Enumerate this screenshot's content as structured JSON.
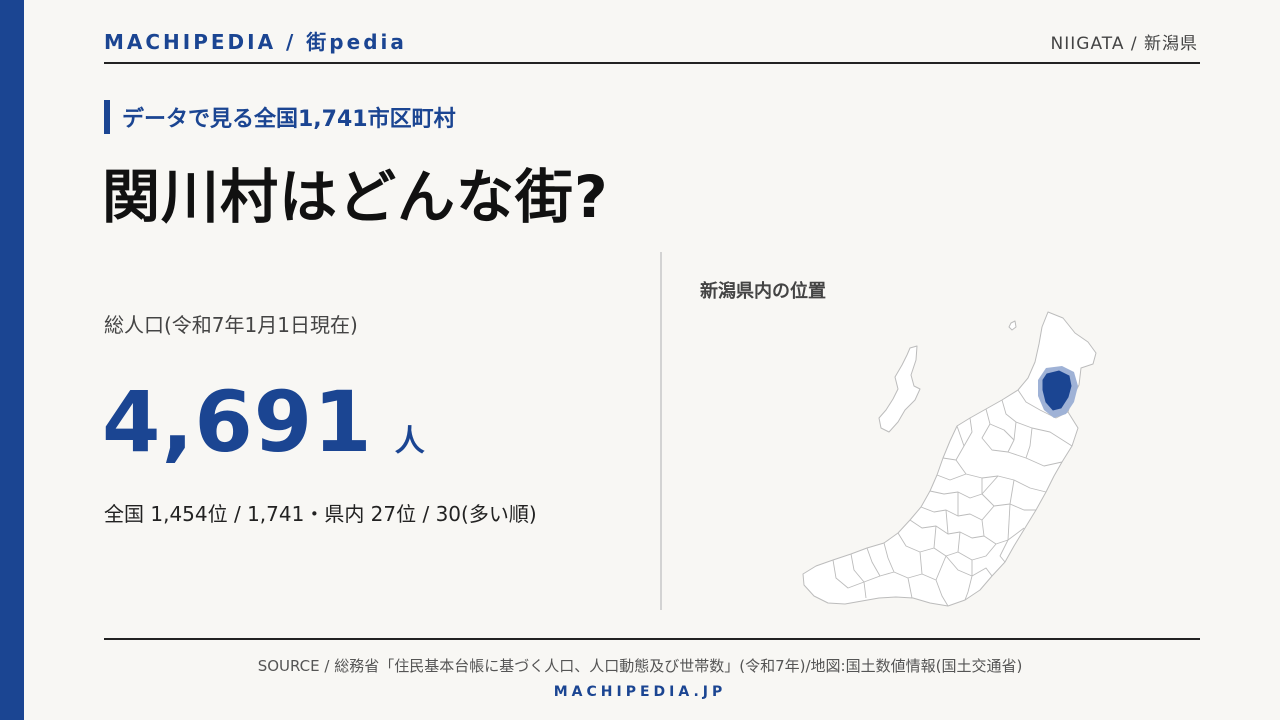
{
  "header": {
    "brand": "MACHIPEDIA / 街pedia",
    "region": "NIIGATA / 新潟県"
  },
  "tag": "データで見る全国1,741市区町村",
  "title": "関川村はどんな街?",
  "population": {
    "label": "総人口(令和7年1月1日現在)",
    "value": "4,691",
    "unit": "人",
    "rank": "全国 1,454位 / 1,741・県内 27位 / 30(多い順)"
  },
  "map": {
    "title": "新潟県内の位置"
  },
  "footer": {
    "source": "SOURCE / 総務省「住民基本台帳に基づく人口、人口動態及び世帯数」(令和7年)/地図:国土数値情報(国土交通省)",
    "site": "MACHIPEDIA.JP"
  },
  "colors": {
    "accent": "#1b4592",
    "highlight_halo": "#9fb2d6",
    "map_fill": "#ffffff",
    "map_border": "#bcbcbc"
  }
}
